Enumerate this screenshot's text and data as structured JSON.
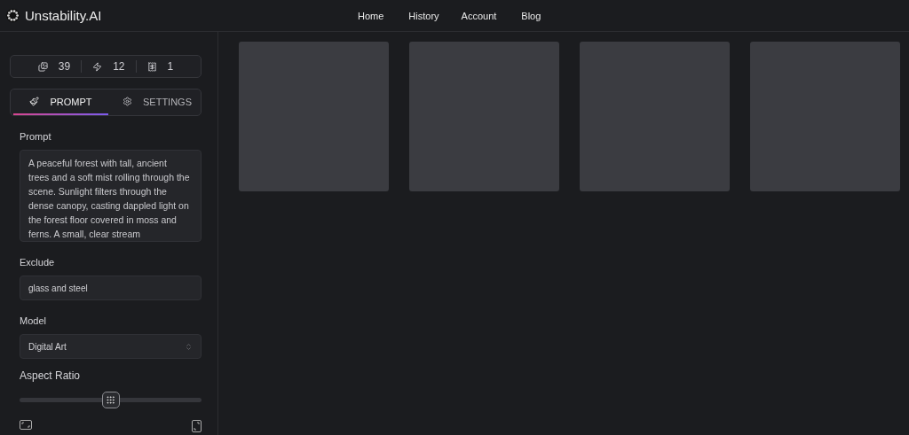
{
  "brand": {
    "name": "Unstability.AI"
  },
  "nav": [
    {
      "label": "Home"
    },
    {
      "label": "History"
    },
    {
      "label": "Account"
    },
    {
      "label": "Blog"
    }
  ],
  "stats": [
    {
      "kind": "images",
      "value": "39"
    },
    {
      "kind": "bolt",
      "value": "12"
    },
    {
      "kind": "credit",
      "value": "1"
    }
  ],
  "tabs": [
    {
      "kind": "prompt",
      "label": "PROMPT",
      "selected": true
    },
    {
      "kind": "settings",
      "label": "SETTINGS",
      "selected": false
    }
  ],
  "prompt": {
    "label": "Prompt",
    "value": "A peaceful forest with tall, ancient trees and a soft mist rolling through the scene. Sunlight filters through the dense canopy, casting dappled light on the forest floor covered in moss and ferns. A small, clear stream"
  },
  "exclude": {
    "label": "Exclude",
    "value": "glass and steel"
  },
  "model": {
    "label": "Model",
    "value": "Digital Art"
  },
  "aspect_ratio": {
    "label": "Aspect Ratio",
    "level": 0.5
  },
  "gallery": [
    {
      "kind": "placeholder"
    },
    {
      "kind": "placeholder"
    },
    {
      "kind": "placeholder"
    },
    {
      "kind": "placeholder"
    }
  ]
}
